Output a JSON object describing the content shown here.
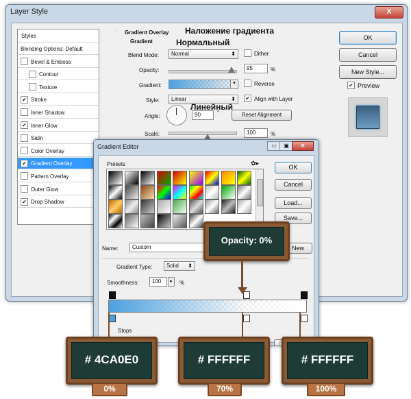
{
  "layer_style": {
    "title": "Layer Style",
    "close": "X",
    "styles_header": "Styles",
    "styles_items": [
      {
        "label": "Blending Options: Default",
        "checkbox": false,
        "checked": false,
        "selected": false,
        "indent": false
      },
      {
        "label": "Bevel & Emboss",
        "checkbox": true,
        "checked": false,
        "selected": false,
        "indent": false
      },
      {
        "label": "Contour",
        "checkbox": true,
        "checked": false,
        "selected": false,
        "indent": true
      },
      {
        "label": "Texture",
        "checkbox": true,
        "checked": false,
        "selected": false,
        "indent": true
      },
      {
        "label": "Stroke",
        "checkbox": true,
        "checked": true,
        "selected": false,
        "indent": false
      },
      {
        "label": "Inner Shadow",
        "checkbox": true,
        "checked": false,
        "selected": false,
        "indent": false
      },
      {
        "label": "Inner Glow",
        "checkbox": true,
        "checked": true,
        "selected": false,
        "indent": false
      },
      {
        "label": "Satin",
        "checkbox": true,
        "checked": false,
        "selected": false,
        "indent": false
      },
      {
        "label": "Color Overlay",
        "checkbox": true,
        "checked": false,
        "selected": false,
        "indent": false
      },
      {
        "label": "Gradient Overlay",
        "checkbox": true,
        "checked": true,
        "selected": true,
        "indent": false
      },
      {
        "label": "Pattern Overlay",
        "checkbox": true,
        "checked": false,
        "selected": false,
        "indent": false
      },
      {
        "label": "Outer Glow",
        "checkbox": true,
        "checked": false,
        "selected": false,
        "indent": false
      },
      {
        "label": "Drop Shadow",
        "checkbox": true,
        "checked": true,
        "selected": false,
        "indent": false
      }
    ],
    "section_title": "Gradient Overlay",
    "section_sub": "Gradient",
    "blend_mode_label": "Blend Mode:",
    "blend_mode_value": "Normal",
    "dither_label": "Dither",
    "opacity_label": "Opacity:",
    "opacity_value": "95",
    "percent": "%",
    "gradient_label": "Gradient:",
    "reverse_label": "Reverse",
    "style_label": "Style:",
    "style_value": "Linear",
    "align_label": "Align with Layer",
    "angle_label": "Angle:",
    "angle_value": "90",
    "degree": "°",
    "reset_alignment": "Reset Alignment",
    "scale_label": "Scale:",
    "scale_value": "100",
    "ok": "OK",
    "cancel": "Cancel",
    "new_style": "New Style...",
    "preview": "Preview"
  },
  "annotations": {
    "gradient_overlay_ru": "Наложение градиента",
    "normal_ru": "Нормальный",
    "linear_ru": "Линейный"
  },
  "gradient_editor": {
    "title": "Gradient Editor",
    "presets_label": "Presets",
    "ok": "OK",
    "cancel": "Cancel",
    "load": "Load...",
    "save": "Save...",
    "name_label": "Name:",
    "name_value": "Custom",
    "new_button": "New",
    "gradient_type_label": "Gradient Type:",
    "gradient_type_value": "Solid",
    "smoothness_label": "Smoothness:",
    "smoothness_value": "100",
    "percent": "%",
    "stops_label": "Stops",
    "delete_label": "De"
  },
  "callouts": {
    "opacity": "Opacity: 0%",
    "stop1_color": "# 4CA0E0",
    "stop2_color": "# FFFFFF",
    "stop3_color": "# FFFFFF",
    "stop1_location": "0%",
    "stop2_location": "70%",
    "stop3_location": "100%"
  },
  "colors": {
    "start_color": "#4CA0E0",
    "accent_selected": "#3399ff"
  }
}
